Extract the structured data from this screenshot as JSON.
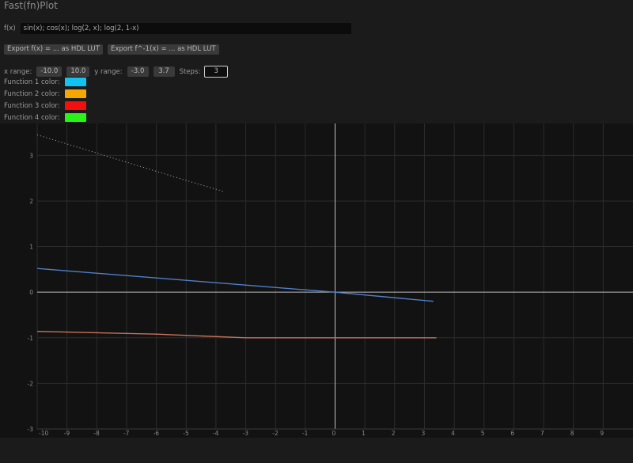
{
  "app": {
    "title": "Fast(fn)Plot"
  },
  "function_input": {
    "label": "f(x)",
    "value": "sin(x); cos(x); log(2, x); log(2, 1-x)"
  },
  "buttons": {
    "export_fx": "Export f(x) = ... as HDL LUT",
    "export_finv": "Export f^-1(x) = ... as HDL LUT"
  },
  "ranges": {
    "x_label": "x range:",
    "x_min": "-10.0",
    "x_max": "10.0",
    "y_label": "y range:",
    "y_min": "-3.0",
    "y_max": "3.7",
    "steps_label": "Steps:",
    "steps": "3"
  },
  "function_colors": [
    {
      "label": "Function 1 color:",
      "color": "#10c3f0"
    },
    {
      "label": "Function 2 color:",
      "color": "#f5a700"
    },
    {
      "label": "Function 3 color:",
      "color": "#f40f0f"
    },
    {
      "label": "Function 4 color:",
      "color": "#29f317"
    }
  ],
  "chart_data": {
    "type": "line",
    "xlim": [
      -10,
      10
    ],
    "ylim": [
      -3,
      3.7
    ],
    "x_ticks": [
      -10,
      -9,
      -8,
      -7,
      -6,
      -5,
      -4,
      -3,
      -2,
      -1,
      0,
      1,
      2,
      3,
      4,
      5,
      6,
      7,
      8,
      9
    ],
    "y_ticks": [
      -3,
      -2,
      -1,
      0,
      1,
      2,
      3
    ],
    "grid": true,
    "axis_color": "#bdbdbd",
    "grid_color": "#2c2c2c",
    "series": [
      {
        "color": "#4f7fc9",
        "x": [
          -10,
          -5,
          0,
          3.3
        ],
        "y": [
          0.52,
          0.26,
          0.0,
          -0.2
        ]
      },
      {
        "color": "#c8735c",
        "x": [
          -10,
          -6,
          -3,
          0,
          3.4
        ],
        "y": [
          -0.86,
          -0.92,
          -1.0,
          -1.0,
          -1.0
        ]
      },
      {
        "color": "#b5b5b5",
        "style": "dotted",
        "x": [
          -10,
          -7.5,
          -5,
          -3.7
        ],
        "y": [
          3.45,
          2.95,
          2.45,
          2.2
        ]
      }
    ]
  }
}
